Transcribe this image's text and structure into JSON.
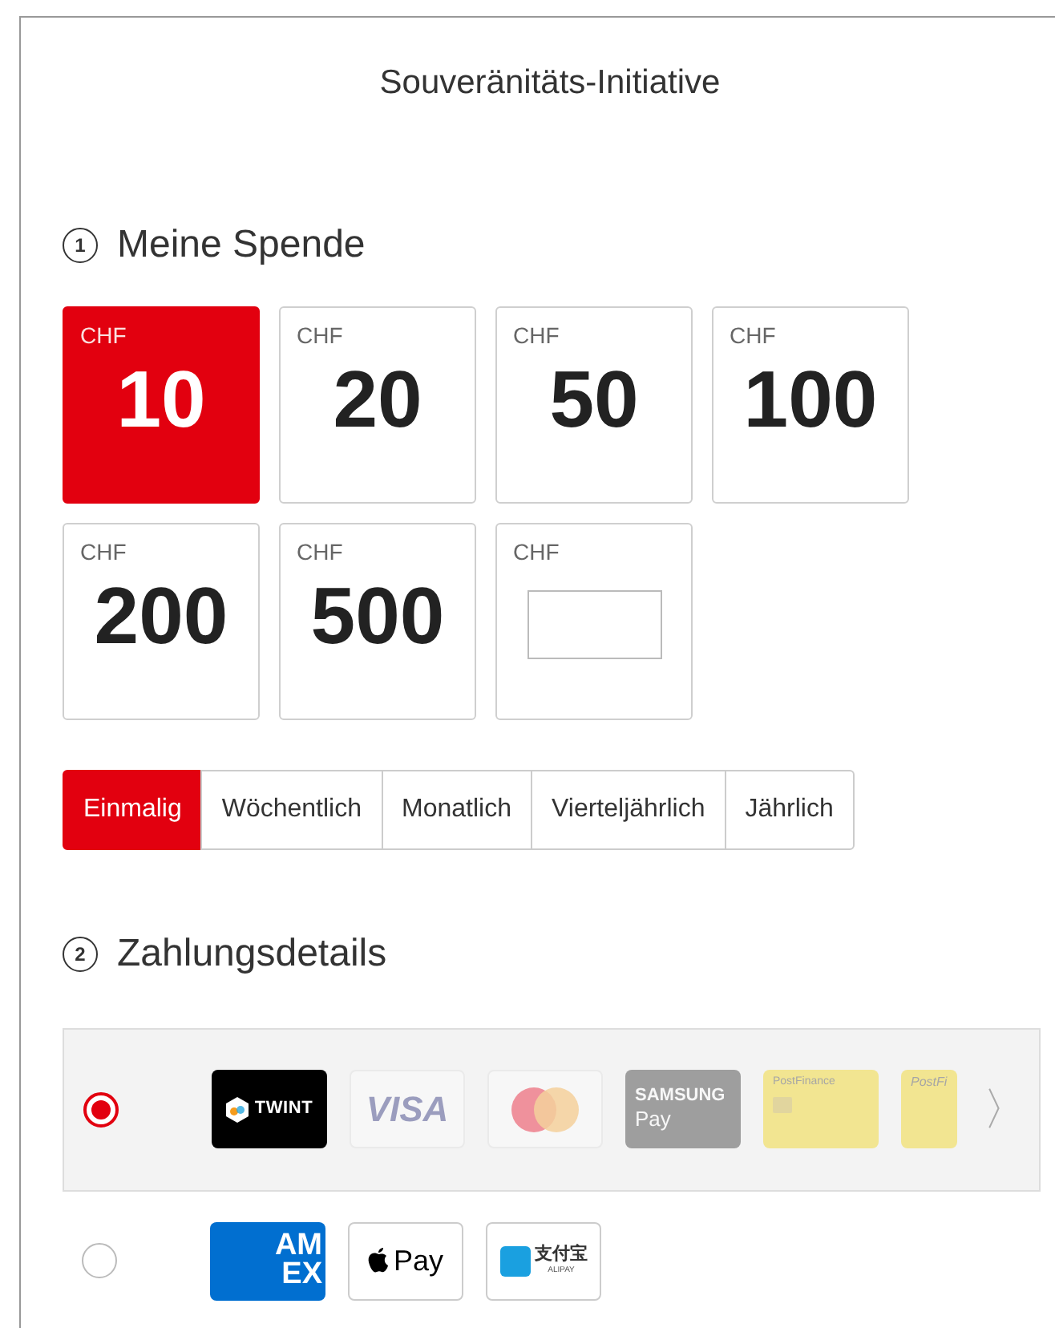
{
  "title": "Souveränitäts-Initiative",
  "sections": [
    {
      "number": "1",
      "heading": "Meine Spende"
    },
    {
      "number": "2",
      "heading": "Zahlungsdetails"
    }
  ],
  "amounts": [
    {
      "currency": "CHF",
      "value": "10",
      "selected": true
    },
    {
      "currency": "CHF",
      "value": "20",
      "selected": false
    },
    {
      "currency": "CHF",
      "value": "50",
      "selected": false
    },
    {
      "currency": "CHF",
      "value": "100",
      "selected": false
    },
    {
      "currency": "CHF",
      "value": "200",
      "selected": false
    },
    {
      "currency": "CHF",
      "value": "500",
      "selected": false
    },
    {
      "currency": "CHF",
      "kind": "custom",
      "selected": false
    }
  ],
  "frequencies": [
    {
      "label": "Einmalig",
      "selected": true
    },
    {
      "label": "Wöchentlich",
      "selected": false
    },
    {
      "label": "Monatlich",
      "selected": false
    },
    {
      "label": "Vierteljährlich",
      "selected": false
    },
    {
      "label": "Jährlich",
      "selected": false
    }
  ],
  "payment_options": [
    {
      "selected": true,
      "more": "〉",
      "methods": [
        {
          "kind": "twint",
          "texts": [
            "TWINT"
          ],
          "faded": false
        },
        {
          "kind": "visa",
          "texts": [
            "VISA"
          ],
          "faded": true
        },
        {
          "kind": "mastercard",
          "faded": true
        },
        {
          "kind": "samsung",
          "texts": [
            "SAMSUNG",
            "Pay"
          ],
          "faded": true
        },
        {
          "kind": "postfinance",
          "texts": [
            "PostFinance"
          ],
          "faded": true
        },
        {
          "kind": "postfinance_cut",
          "texts": [
            "PostFi"
          ],
          "faded": true
        }
      ]
    },
    {
      "selected": false,
      "methods": [
        {
          "kind": "amex",
          "texts": [
            "AM",
            "EX"
          ],
          "faded": false
        },
        {
          "kind": "applepay",
          "texts": [
            "Pay"
          ],
          "faded": false
        },
        {
          "kind": "alipay",
          "texts": [
            "支付宝",
            "ALIPAY"
          ],
          "faded": false
        }
      ]
    }
  ]
}
